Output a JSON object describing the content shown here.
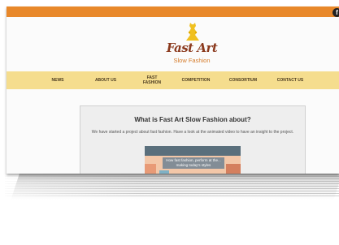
{
  "social": {
    "facebook_glyph": "f"
  },
  "brand": {
    "title": "Fast Art",
    "subtitle": "Slow Fashion"
  },
  "nav": {
    "items": [
      {
        "label": "NEWS"
      },
      {
        "label": "ABOUT US"
      },
      {
        "label": "FAST FASHION"
      },
      {
        "label": "COMPETITION"
      },
      {
        "label": "CONSORTIUM"
      },
      {
        "label": "CONTACT US"
      }
    ]
  },
  "main": {
    "title": "What is Fast Art Slow Fashion about?",
    "description": "We have started a project about fast fashion. Have a look at the animated video to have an insight to the project.",
    "video_caption": "How fast fashion, perform at the... making today's styles"
  },
  "colors": {
    "top_bar": "#e8882a",
    "nav_bar": "#f5dd8e",
    "logo_mark": "#f0c020",
    "logo_title": "#8b3a1e",
    "logo_sub": "#d57b2a"
  }
}
